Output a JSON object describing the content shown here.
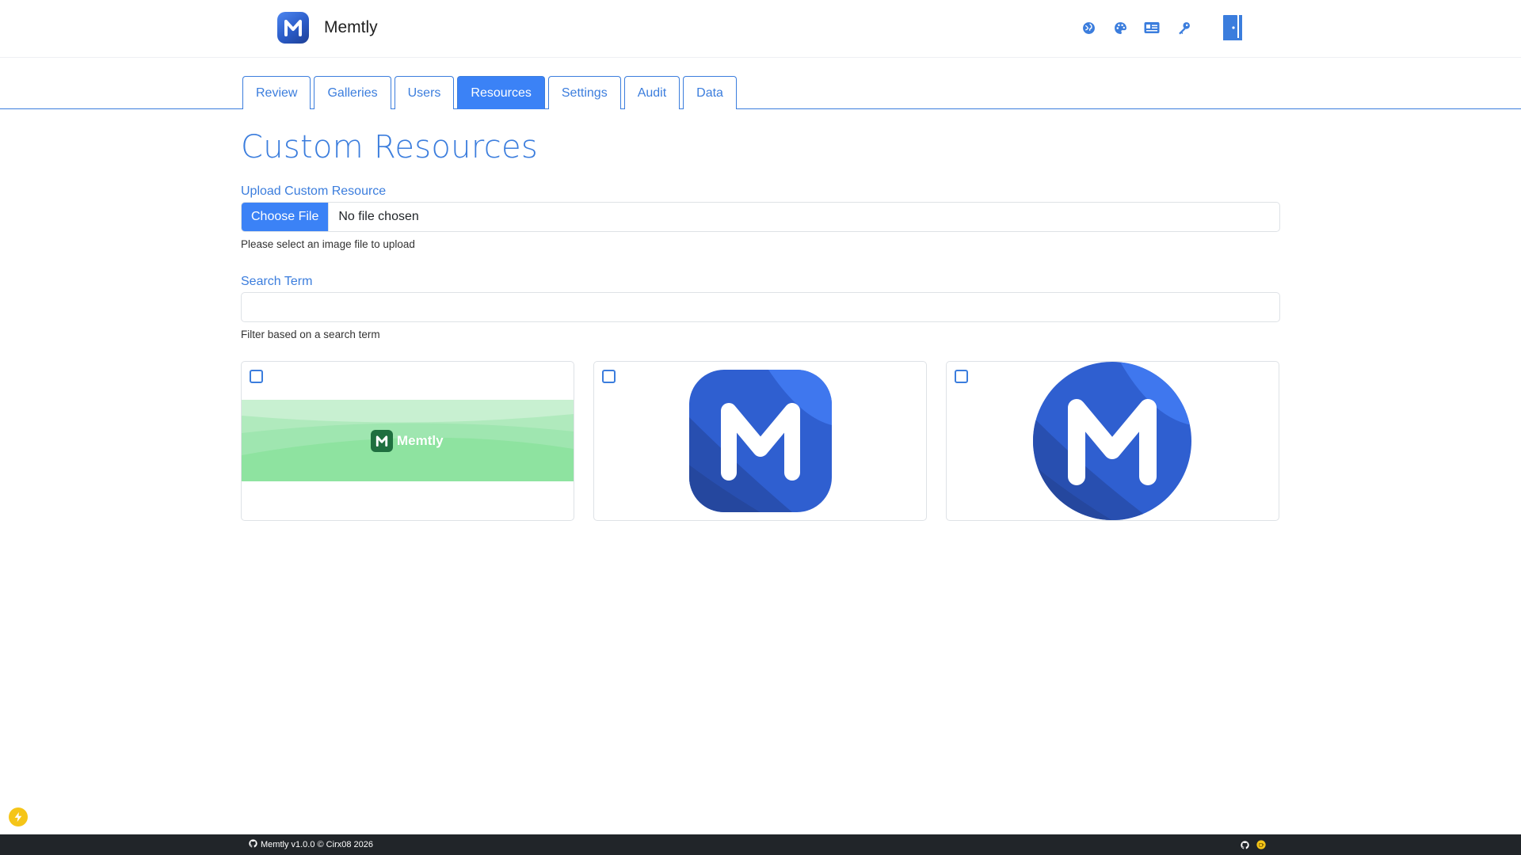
{
  "app": {
    "name": "Memtly"
  },
  "header": {
    "icons": [
      "language-icon",
      "palette-icon",
      "id-card-icon",
      "key-icon",
      "logout-door-icon"
    ]
  },
  "tabs": [
    {
      "label": "Review",
      "active": false
    },
    {
      "label": "Galleries",
      "active": false
    },
    {
      "label": "Users",
      "active": false
    },
    {
      "label": "Resources",
      "active": true
    },
    {
      "label": "Settings",
      "active": false
    },
    {
      "label": "Audit",
      "active": false
    },
    {
      "label": "Data",
      "active": false
    }
  ],
  "main": {
    "title": "Custom Resources",
    "upload": {
      "label": "Upload Custom Resource",
      "button": "Choose File",
      "status": "No file chosen",
      "help": "Please select an image file to upload"
    },
    "search": {
      "label": "Search Term",
      "value": "",
      "placeholder": "",
      "help": "Filter based on a search term"
    },
    "resources": [
      {
        "type": "banner",
        "logo_text": "Memtly",
        "checked": false
      },
      {
        "type": "icon-square",
        "checked": false
      },
      {
        "type": "icon-circle",
        "checked": false
      }
    ]
  },
  "footer": {
    "text": "Memtly v1.0.0 © Cirx08 2026"
  },
  "colors": {
    "accent": "#3b7ddd",
    "tab_active": "#3b82f6",
    "logo_blue": "#2f5fd0",
    "banner_green": "#8ee3a0",
    "footer_bg": "#212529",
    "fab_yellow": "#f5c518"
  }
}
